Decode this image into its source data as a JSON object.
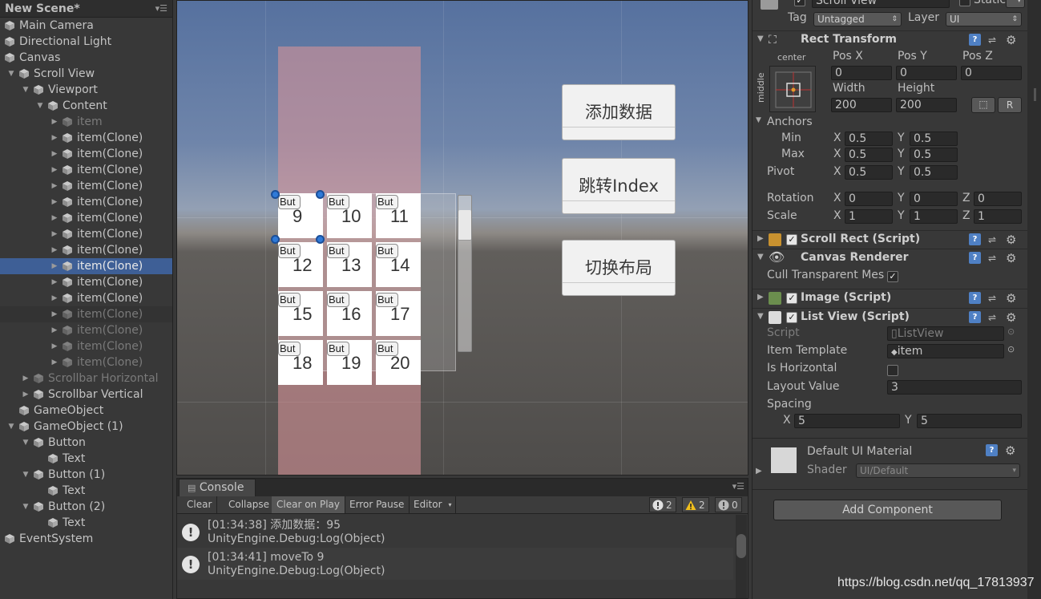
{
  "hierarchy": {
    "scene_name": "New Scene*",
    "items": [
      {
        "label": "Main Camera"
      },
      {
        "label": "Directional Light"
      },
      {
        "label": "Canvas"
      },
      {
        "label": "Scroll View"
      },
      {
        "label": "Viewport"
      },
      {
        "label": "Content"
      },
      {
        "label": "item"
      },
      {
        "label": "item(Clone)"
      },
      {
        "label": "item(Clone)"
      },
      {
        "label": "item(Clone)"
      },
      {
        "label": "item(Clone)"
      },
      {
        "label": "item(Clone)"
      },
      {
        "label": "item(Clone)"
      },
      {
        "label": "item(Clone)"
      },
      {
        "label": "item(Clone)"
      },
      {
        "label": "item(Clone)"
      },
      {
        "label": "item(Clone)"
      },
      {
        "label": "item(Clone)"
      },
      {
        "label": "item(Clone)"
      },
      {
        "label": "item(Clone)"
      },
      {
        "label": "item(Clone)"
      },
      {
        "label": "item(Clone)"
      },
      {
        "label": "Scrollbar Horizontal"
      },
      {
        "label": "Scrollbar Vertical"
      },
      {
        "label": "GameObject"
      },
      {
        "label": "GameObject (1)"
      },
      {
        "label": "Button"
      },
      {
        "label": "Text"
      },
      {
        "label": "Button (1)"
      },
      {
        "label": "Text"
      },
      {
        "label": "Button (2)"
      },
      {
        "label": "Text"
      },
      {
        "label": "EventSystem"
      }
    ]
  },
  "scene": {
    "cell_button_label": "But",
    "cells": [
      "9",
      "10",
      "11",
      "12",
      "13",
      "14",
      "15",
      "16",
      "17",
      "18",
      "19",
      "20"
    ],
    "buttons": [
      "添加数据",
      "跳转Index",
      "切换布局"
    ]
  },
  "console": {
    "tab": "Console",
    "toolbar": [
      "Clear",
      "Collapse",
      "Clear on Play",
      "Error Pause",
      "Editor"
    ],
    "counts": {
      "info": "2",
      "warning": "2",
      "error": "0"
    },
    "logs": [
      {
        "line1": "[01:34:38] 添加数据：95",
        "line2": "UnityEngine.Debug:Log(Object)"
      },
      {
        "line1": "[01:34:41] moveTo 9",
        "line2": "UnityEngine.Debug:Log(Object)"
      }
    ]
  },
  "inspector": {
    "object_name": "Scroll View",
    "static_label": "Static",
    "tag_label": "Tag",
    "tag_value": "Untagged",
    "layer_label": "Layer",
    "layer_value": "UI",
    "rect_transform": {
      "title": "Rect Transform",
      "anchor_h": "center",
      "anchor_v": "middle",
      "pos_labels": [
        "Pos X",
        "Pos Y",
        "Pos Z"
      ],
      "pos_values": [
        "0",
        "0",
        "0"
      ],
      "size_labels": [
        "Width",
        "Height"
      ],
      "size_values": [
        "200",
        "200"
      ],
      "r_button": "R",
      "anchors_label": "Anchors",
      "min_label": "Min",
      "max_label": "Max",
      "pivot_label": "Pivot",
      "rotation_label": "Rotation",
      "scale_label": "Scale",
      "axis_x": "X",
      "axis_y": "Y",
      "axis_z": "Z",
      "anchor_min": [
        "0.5",
        "0.5"
      ],
      "anchor_max": [
        "0.5",
        "0.5"
      ],
      "pivot": [
        "0.5",
        "0.5"
      ],
      "rotation": [
        "0",
        "0",
        "0"
      ],
      "scale": [
        "1",
        "1",
        "1"
      ]
    },
    "scroll_rect": "Scroll Rect (Script)",
    "canvas_renderer": {
      "title": "Canvas Renderer",
      "cull_label": "Cull Transparent Mes"
    },
    "image": "Image (Script)",
    "list_view": {
      "title": "List View (Script)",
      "script_label": "Script",
      "script_value": "ListView",
      "template_label": "Item Template",
      "template_value": "item",
      "horizontal_label": "Is Horizontal",
      "layout_label": "Layout Value",
      "layout_value": "3",
      "spacing_label": "Spacing",
      "spacing_x": "5",
      "spacing_y": "5"
    },
    "material": {
      "name": "Default UI Material",
      "shader_label": "Shader",
      "shader_value": "UI/Default"
    },
    "add_component": "Add Component"
  },
  "watermark": "https://blog.csdn.net/qq_17813937"
}
